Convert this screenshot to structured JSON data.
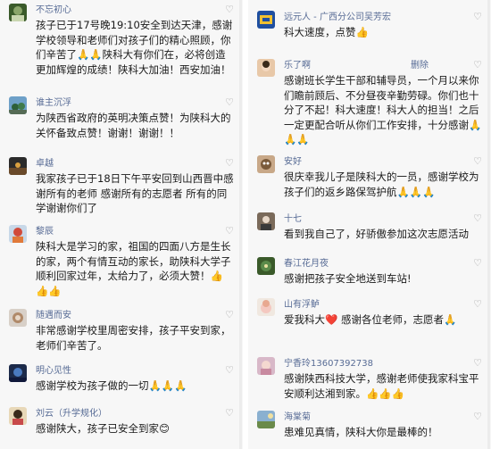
{
  "left": {
    "comments": [
      {
        "nick": "不忘初心",
        "text": "孩子已于17号晚19:10安全到达天津，感谢学校领导和老师们对孩子们的精心照顾，你们辛苦了🙏🙏陕科大有你们在，必将创造更加辉煌的成绩！陕科大加油！西安加油！"
      },
      {
        "nick": "谁主沉浮",
        "text": "为陕西省政府的英明决策点赞！为陕科大的关怀备致点赞！谢谢！谢谢！！"
      },
      {
        "nick": "卓越",
        "text": "我家孩子已于18日下午平安回到山西晋中感谢所有的老师 感谢所有的志愿者 所有的同学谢谢你们了"
      },
      {
        "nick": "黎辰",
        "text": "陕科大是学习的家，祖国的四面八方是生长的家，两个有情互动的家长，助陕科大学子顺利回家过年，太给力了，必须大赞！👍👍👍"
      },
      {
        "nick": "随遇而安",
        "text": "非常感谢学校里周密安排，孩子平安到家，老师们辛苦了。"
      },
      {
        "nick": "明心见性",
        "text": "感谢学校为孩子做的一切🙏🙏🙏"
      },
      {
        "nick": "刘云（升学规化）",
        "text": "感谢陕大，孩子已安全到家😊"
      }
    ]
  },
  "right": {
    "comments": [
      {
        "nick": "远元人 - 广西分公司吴芳宏",
        "text": "科大速度，点赞👍",
        "has_delete": false
      },
      {
        "nick": "乐了啊",
        "text": "感谢班长学生干部和辅导员，一个月以来你们瞻前顾后、不分昼夜辛勤劳碌。你们也十分了不起！科大速度！科大人的担当！之后一定更配合听从你们工作安排，十分感谢🙏🙏🙏",
        "has_delete": true,
        "delete_label": "删除"
      },
      {
        "nick": "安好",
        "text": "很庆幸我儿子是陕科大的一员，感谢学校为孩子们的返乡路保驾护航🙏🙏🙏",
        "has_delete": false
      },
      {
        "nick": "十七",
        "text": "看到我自己了，好骄傲参加这次志愿活动",
        "has_delete": false
      },
      {
        "nick": "春江花月夜",
        "text": "感谢把孩子安全地送到车站!",
        "has_delete": false
      },
      {
        "nick": "山有浮鲈",
        "text": "爱我科大❤️ 感谢各位老师，志愿者🙏",
        "has_delete": false
      },
      {
        "nick": "宁香玲13607392738",
        "text": "感谢陕西科技大学，感谢老师使我家科宝平安顺利达湘到家。👍👍👍",
        "has_delete": false
      },
      {
        "nick": "海棠菊",
        "text": "患难见真情，陕科大你是最棒的！",
        "has_delete": false
      }
    ]
  },
  "like_glyph": "♡",
  "avatar_icons": [
    "avatar-icon"
  ]
}
